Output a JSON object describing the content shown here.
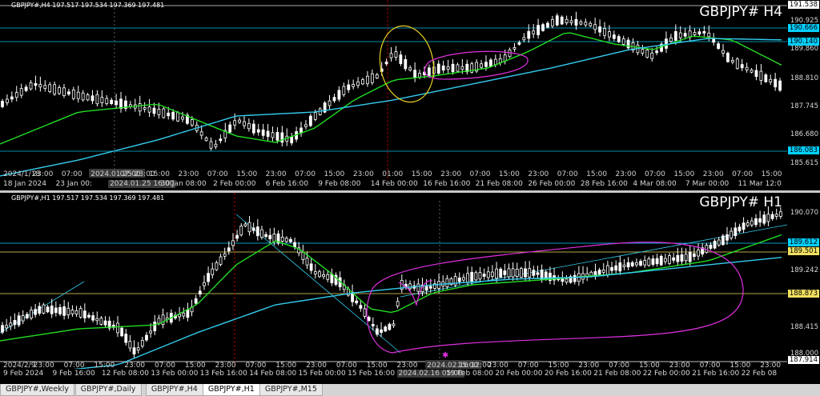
{
  "top_chart": {
    "info": "GBPJPY#,H4  197.517 197.534 197.369 197.481",
    "symbol_label": "GBPJPY#  H4",
    "price_ticks": [
      "190.925",
      "189.860",
      "188.810",
      "187.745",
      "186.680",
      "185.615"
    ],
    "hlines": [
      {
        "label": "191.538",
        "color": "#ffffff",
        "text": "#000000"
      },
      {
        "label": "190.666",
        "color": "#00d0ff",
        "text": "#000000"
      },
      {
        "label": "190.140",
        "color": "#00d0ff",
        "text": "#000000"
      },
      {
        "label": "186.083",
        "color": "#00d0ff",
        "text": "#000000"
      }
    ],
    "time_ticks": [
      "18 Jan 2024",
      "23 Jan 00:",
      "2024.01.25 16:00",
      "30 Jan 08:00",
      "2 Feb 00:00",
      "6 Feb 16:00",
      "9 Feb 08:00",
      "14 Feb 00:00",
      "16 Feb 16:00",
      "21 Feb 08:00",
      "26 Feb 00:00",
      "28 Feb 16:00",
      "4 Mar 08:00",
      "7 Mar 00:00",
      "11 Mar 12:0"
    ],
    "inner_ticks": [
      "2024/1/18",
      "23:00",
      "07:00",
      "2024.01.25 23:00",
      "07:00",
      "15:00",
      "23:00",
      "07:00",
      "15:00",
      "23:00",
      "07:00",
      "15:00",
      "23:00",
      "01:00",
      "15:00",
      "23:00",
      "07:00",
      "15:00",
      "23:00",
      "07:00",
      "15:00",
      "23:00",
      "07:00",
      "15:00",
      "23:00",
      "07:00",
      "15:00"
    ]
  },
  "bottom_chart": {
    "info": "GBPJPY#,H1  197.517 197.534 197.369 197.481",
    "symbol_label": "GBPJPY#  H1",
    "price_ticks": [
      "190.070",
      "189.242",
      "188.415",
      "188.000"
    ],
    "hlines": [
      {
        "label": "189.612",
        "color": "#00d0ff",
        "text": "#000000"
      },
      {
        "label": "189.501",
        "color": "#f0e060",
        "text": "#000000"
      },
      {
        "label": "188.873",
        "color": "#f0e060",
        "text": "#000000"
      },
      {
        "label": "187.914",
        "color": "#ffffff",
        "text": "#000000"
      }
    ],
    "time_ticks": [
      "9 Feb 2024",
      "9 Feb 16:00",
      "12 Feb 08:00",
      "13 Feb 00:00",
      "13 Feb 16:00",
      "14 Feb 08:00",
      "15 Feb 00:00",
      "15 Feb 16:00",
      "2024.02.16 05:00",
      "19 Feb 08:00",
      "20 Feb 00:00",
      "20 Feb 16:00",
      "21 Feb 08:00",
      "22 Feb 00:00",
      "21 Feb 16:00",
      "22 Feb 08"
    ],
    "inner_ticks": [
      "2024/2/9",
      "23:00",
      "07:00",
      "15:00",
      "23:00",
      "07:00",
      "15:00",
      "23:00",
      "07:00",
      "15:00",
      "23:00",
      "07:00",
      "15:00",
      "23:00",
      "2024.02.16 12:00",
      "15:00",
      "23:00",
      "07:00",
      "15:00",
      "23:00",
      "07:00",
      "15:00",
      "23:00",
      "07:00",
      "15:00",
      "23:00"
    ]
  },
  "tabs": [
    {
      "label": "GBPJPY#,Weekly",
      "active": false
    },
    {
      "label": "GBPJPY#,Daily",
      "active": false
    },
    {
      "label": "GBPJPY#,H4",
      "active": false
    },
    {
      "label": "GBPJPY#,H1",
      "active": true
    },
    {
      "label": "GBPJPY#,M15",
      "active": false
    }
  ],
  "colors": {
    "bg": "#000000",
    "candle": "#ffffff",
    "ma_fast": "#22dd22",
    "ma_slow": "#33ccee",
    "annot_yellow": "#e8d020",
    "annot_magenta": "#e030e0",
    "vline": "#c00000"
  }
}
